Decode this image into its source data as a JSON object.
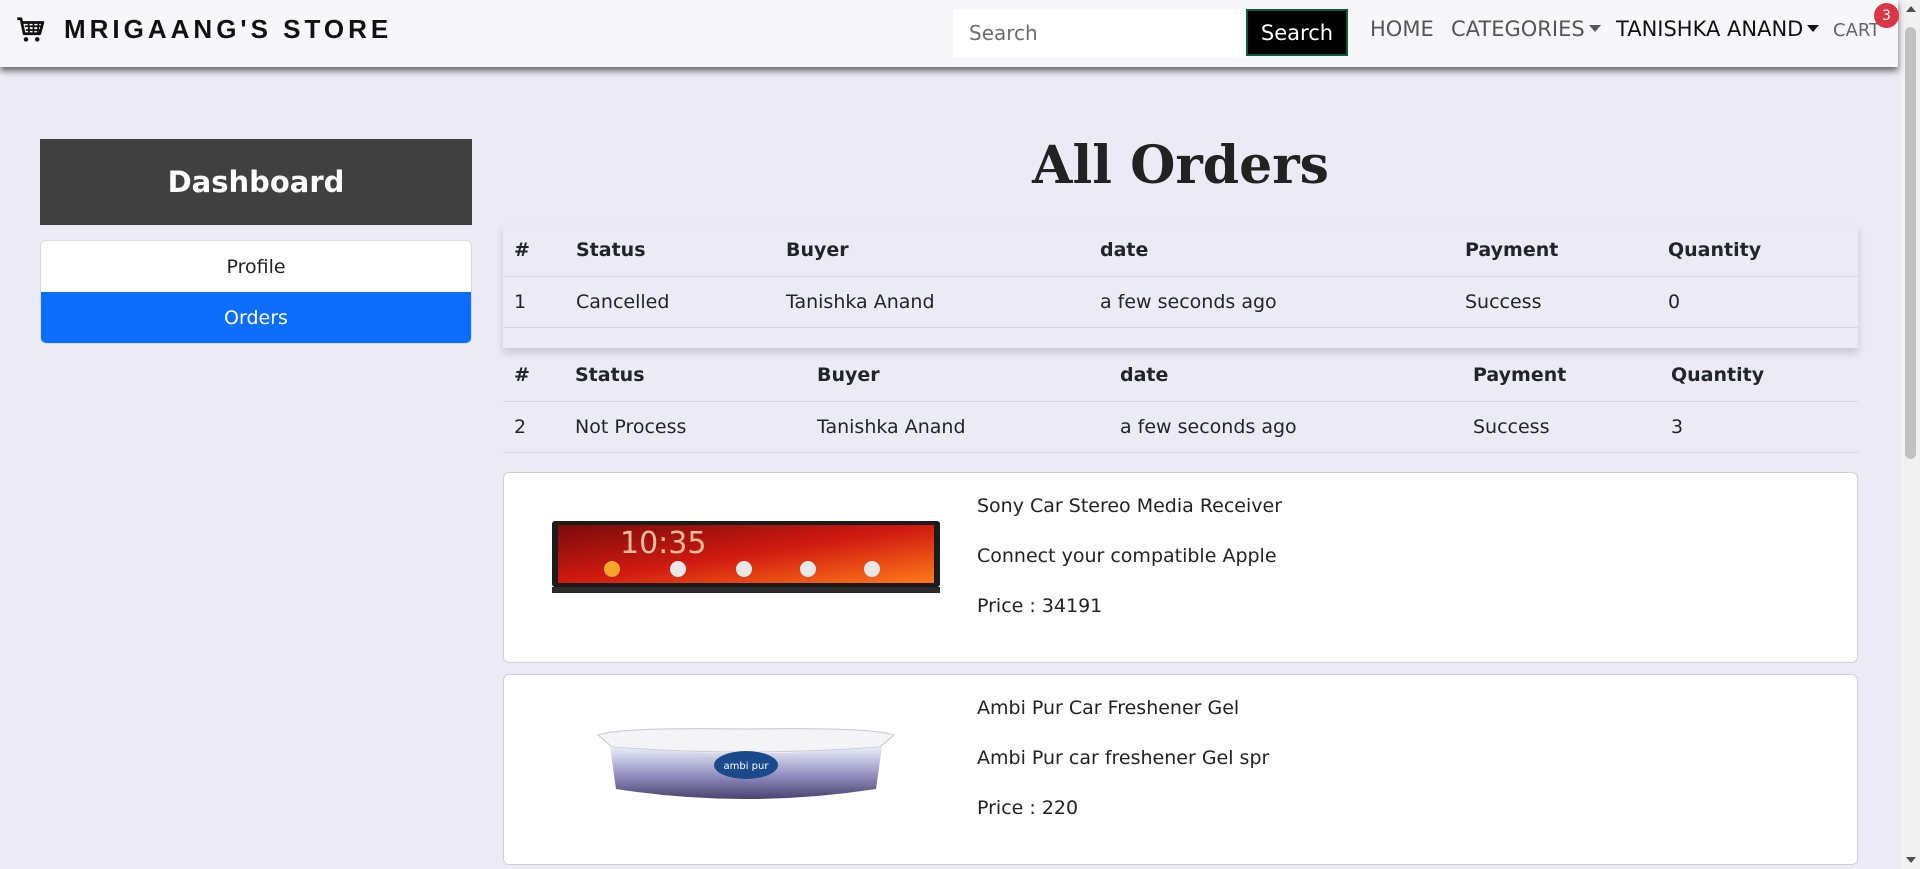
{
  "navbar": {
    "brand": "MRIGAANG'S STORE",
    "search_placeholder": "Search",
    "search_button": "Search",
    "home": "HOME",
    "categories": "CATEGORIES",
    "user": "TANISHKA ANAND",
    "cart": "CART",
    "cart_count": "3"
  },
  "sidebar": {
    "title": "Dashboard",
    "items": [
      {
        "label": "Profile",
        "active": false
      },
      {
        "label": "Orders",
        "active": true
      }
    ]
  },
  "main": {
    "title": "All Orders",
    "columns": [
      "#",
      "Status",
      "Buyer",
      "date",
      "Payment",
      "Quantity"
    ],
    "orders": [
      {
        "num": "1",
        "status": "Cancelled",
        "buyer": "Tanishka Anand",
        "date": "a few seconds ago",
        "payment": "Success",
        "quantity": "0",
        "products": []
      },
      {
        "num": "2",
        "status": "Not Process",
        "buyer": "Tanishka Anand",
        "date": "a few seconds ago",
        "payment": "Success",
        "quantity": "3",
        "products": [
          {
            "name": "Sony Car Stereo Media Receiver",
            "description": "Connect your compatible Apple",
            "price": "Price : 34191"
          },
          {
            "name": "Ambi Pur Car Freshener Gel",
            "description": "Ambi Pur car freshener Gel spr",
            "price": "Price : 220"
          }
        ]
      }
    ]
  },
  "colors": {
    "accent": "#0d6efd",
    "badge": "#dc3545",
    "dashboard_header": "#404040",
    "background": "#eceaf5"
  }
}
